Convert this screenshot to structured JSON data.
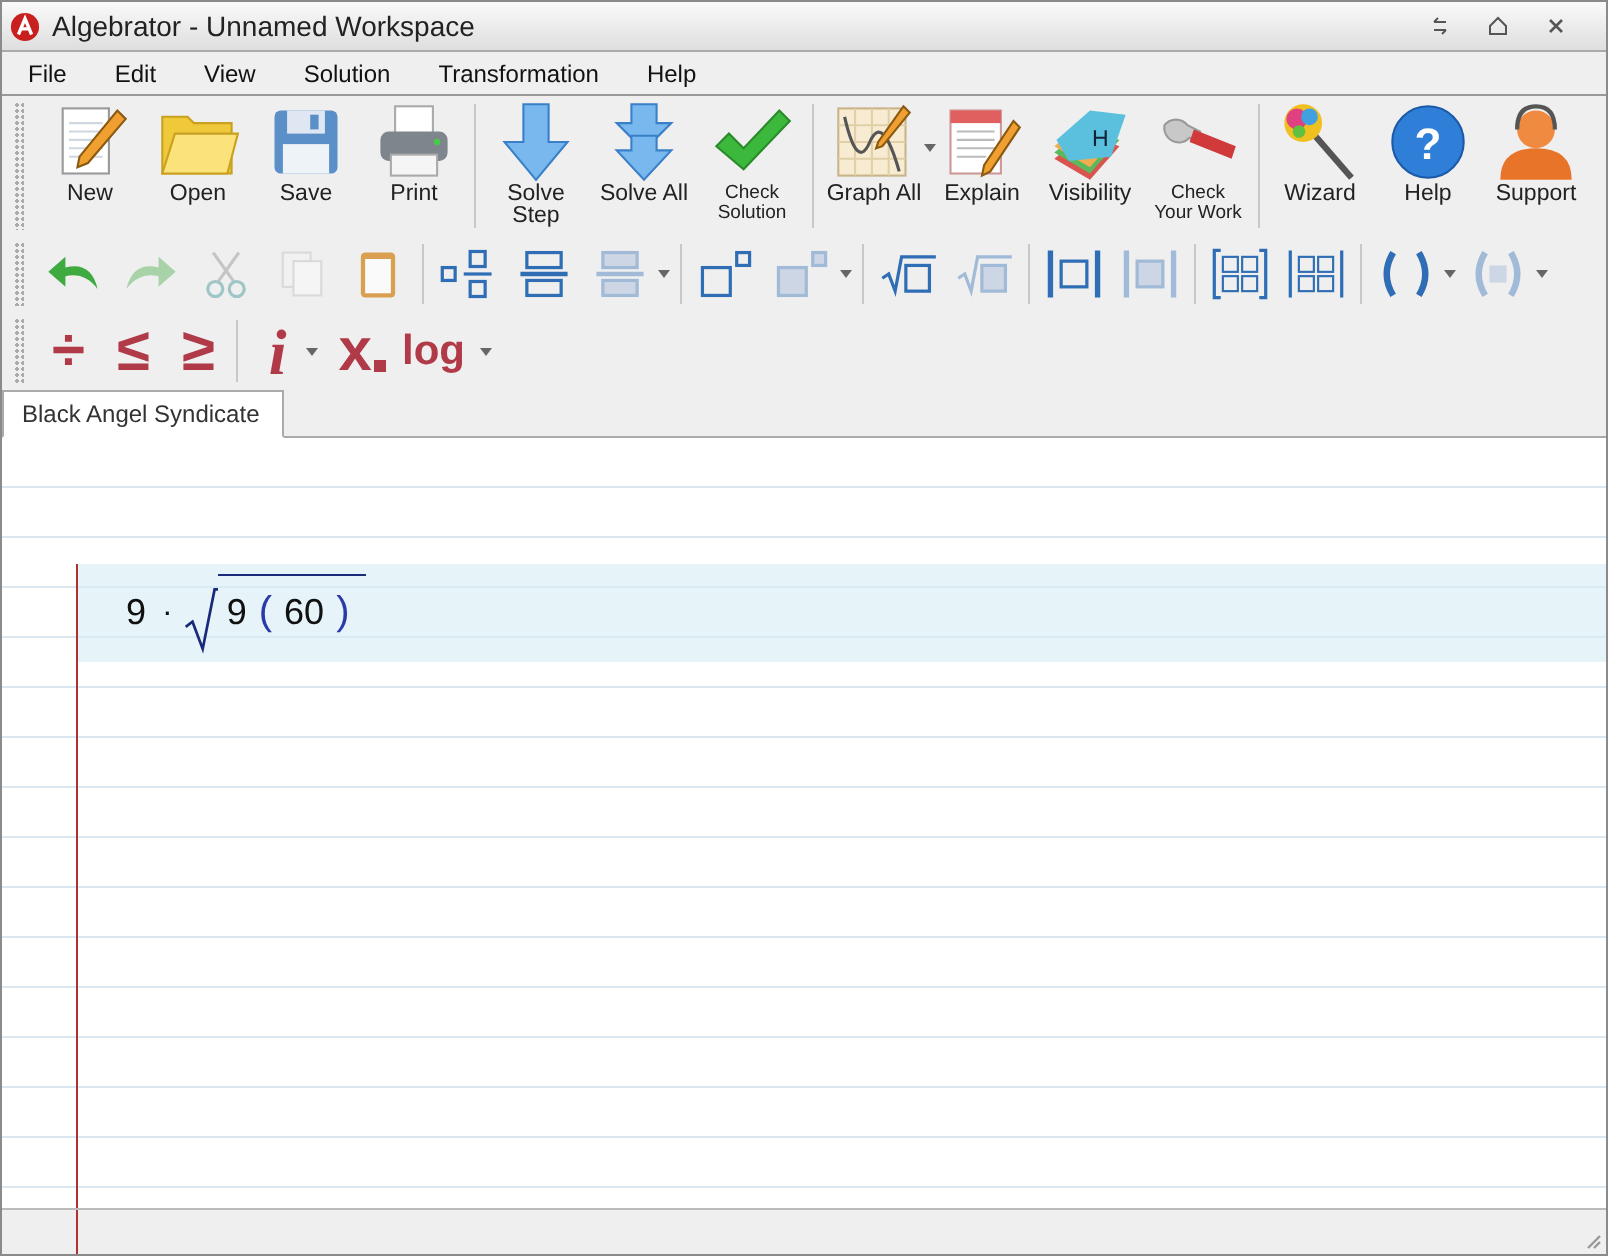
{
  "window": {
    "title": "Algebrator - Unnamed Workspace"
  },
  "menu": [
    "File",
    "Edit",
    "View",
    "Solution",
    "Transformation",
    "Help"
  ],
  "toolbar": [
    [
      {
        "kind": "new",
        "label": "New"
      },
      {
        "kind": "open",
        "label": "Open"
      },
      {
        "kind": "save",
        "label": "Save"
      },
      {
        "kind": "print",
        "label": "Print"
      }
    ],
    [
      {
        "kind": "solve-step",
        "label": "Solve Step"
      },
      {
        "kind": "solve-all",
        "label": "Solve All"
      },
      {
        "kind": "check",
        "label": "Check Solution"
      }
    ],
    [
      {
        "kind": "graph",
        "label": "Graph All",
        "dropdown": true
      },
      {
        "kind": "explain",
        "label": "Explain"
      },
      {
        "kind": "visibility",
        "label": "Visibility",
        "badge": "H"
      },
      {
        "kind": "check-work",
        "label": "Check Your Work"
      }
    ],
    [
      {
        "kind": "wizard",
        "label": "Wizard"
      },
      {
        "kind": "help",
        "label": "Help",
        "badge": "?"
      },
      {
        "kind": "support",
        "label": "Support"
      }
    ]
  ],
  "format_bar": [
    [
      {
        "kind": "undo",
        "disabled": false
      },
      {
        "kind": "redo",
        "disabled": true
      },
      {
        "kind": "cut",
        "disabled": true
      },
      {
        "kind": "copy",
        "disabled": true
      },
      {
        "kind": "paste",
        "disabled": false
      }
    ],
    [
      {
        "kind": "fraction",
        "disabled": false
      },
      {
        "kind": "over",
        "disabled": false
      },
      {
        "kind": "stacked",
        "disabled": true,
        "dropdown": true
      }
    ],
    [
      {
        "kind": "power",
        "disabled": false
      },
      {
        "kind": "power-filled",
        "disabled": true,
        "dropdown": true
      }
    ],
    [
      {
        "kind": "root",
        "disabled": false
      },
      {
        "kind": "root-filled",
        "disabled": true
      }
    ],
    [
      {
        "kind": "abs",
        "disabled": false
      },
      {
        "kind": "abs-filled",
        "disabled": true
      }
    ],
    [
      {
        "kind": "matrix",
        "disabled": false
      },
      {
        "kind": "det",
        "disabled": false
      }
    ],
    [
      {
        "kind": "parens",
        "disabled": false,
        "dropdown": true
      },
      {
        "kind": "parens-filled",
        "disabled": true,
        "dropdown": true
      }
    ]
  ],
  "symbol_bar": [
    [
      {
        "kind": "plain",
        "symbol": "÷"
      },
      {
        "kind": "plain",
        "symbol": "≤"
      },
      {
        "kind": "plain",
        "symbol": "≥"
      }
    ],
    [
      {
        "kind": "italic",
        "symbol": "i",
        "dropdown": true
      },
      {
        "kind": "subscript",
        "symbol": "x"
      },
      {
        "kind": "word",
        "symbol": "log",
        "dropdown": true
      }
    ]
  ],
  "tabs": [
    {
      "label": "Black Angel Syndicate",
      "selected": true
    }
  ],
  "expression": {
    "coefficient": "9",
    "operator": "·",
    "radicand": "9",
    "open": "(",
    "argument": "60",
    "close": ")"
  }
}
